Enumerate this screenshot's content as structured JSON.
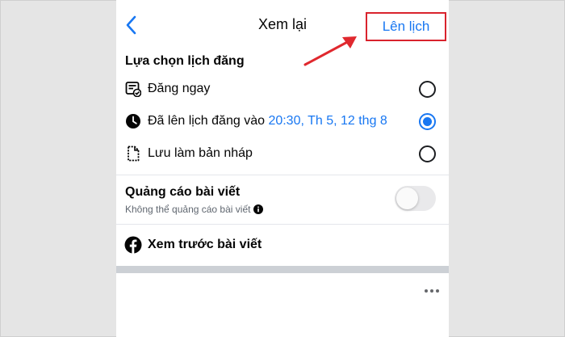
{
  "header": {
    "title": "Xem lại",
    "schedule_label": "Lên lịch",
    "back_icon": "chevron-left-icon"
  },
  "schedule_options": {
    "heading": "Lựa chọn lịch đăng",
    "items": [
      {
        "label": "Đăng ngay",
        "value": "",
        "icon": "post-now-icon",
        "checked": false
      },
      {
        "label": "Đã lên lịch đăng vào ",
        "value": "20:30, Th 5, 12 thg 8",
        "icon": "clock-icon",
        "checked": true
      },
      {
        "label": "Lưu làm bản nháp",
        "value": "",
        "icon": "draft-icon",
        "checked": false
      }
    ]
  },
  "boost": {
    "title": "Quảng cáo bài viết",
    "subtitle": "Không thể quảng cáo bài viết",
    "enabled": false
  },
  "preview": {
    "label": "Xem trước bài viết",
    "icon": "facebook-icon"
  },
  "colors": {
    "accent": "#1877f2",
    "highlight_border": "#d9232d",
    "arrow": "#e0282e"
  }
}
